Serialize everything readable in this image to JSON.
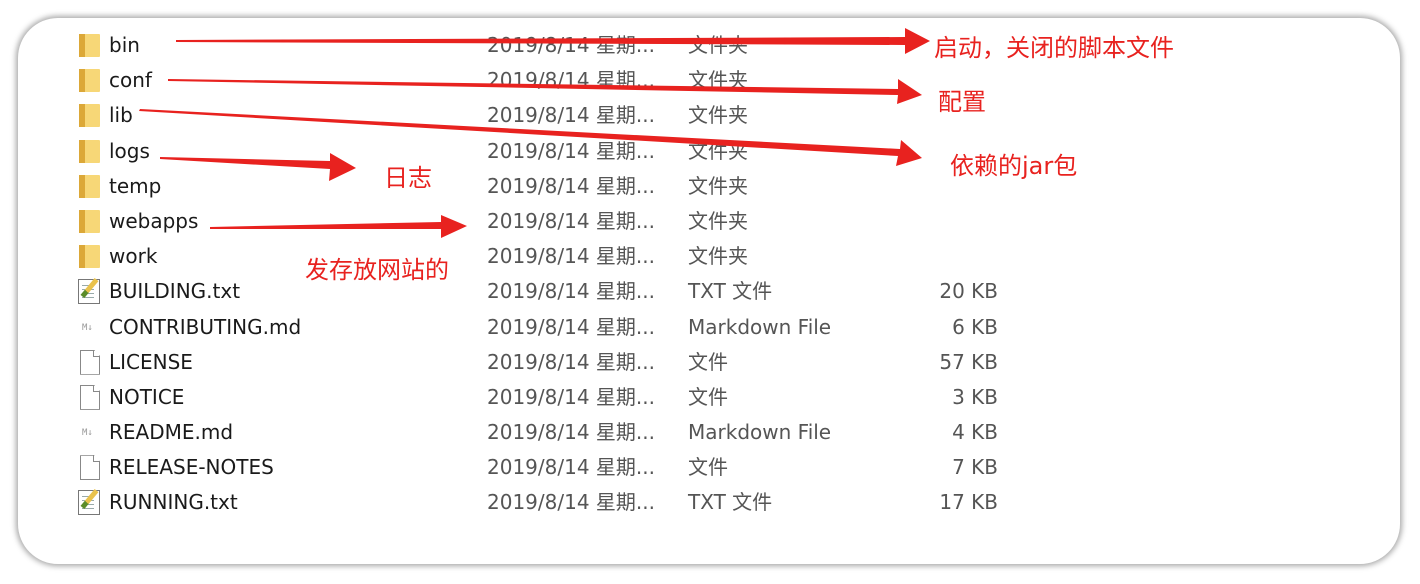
{
  "files": [
    {
      "name": "bin",
      "date": "2019/8/14 星期...",
      "type": "文件夹",
      "size": "",
      "icon": "folder-icon"
    },
    {
      "name": "conf",
      "date": "2019/8/14 星期...",
      "type": "文件夹",
      "size": "",
      "icon": "folder-icon"
    },
    {
      "name": "lib",
      "date": "2019/8/14 星期...",
      "type": "文件夹",
      "size": "",
      "icon": "folder-icon"
    },
    {
      "name": "logs",
      "date": "2019/8/14 星期...",
      "type": "文件夹",
      "size": "",
      "icon": "folder-icon"
    },
    {
      "name": "temp",
      "date": "2019/8/14 星期...",
      "type": "文件夹",
      "size": "",
      "icon": "folder-icon"
    },
    {
      "name": "webapps",
      "date": "2019/8/14 星期...",
      "type": "文件夹",
      "size": "",
      "icon": "folder-icon"
    },
    {
      "name": "work",
      "date": "2019/8/14 星期...",
      "type": "文件夹",
      "size": "",
      "icon": "folder-icon"
    },
    {
      "name": "BUILDING.txt",
      "date": "2019/8/14 星期...",
      "type": "TXT 文件",
      "size": "20 KB",
      "icon": "text-file-icon"
    },
    {
      "name": "CONTRIBUTING.md",
      "date": "2019/8/14 星期...",
      "type": "Markdown File",
      "size": "6 KB",
      "icon": "markdown-file-icon"
    },
    {
      "name": "LICENSE",
      "date": "2019/8/14 星期...",
      "type": "文件",
      "size": "57 KB",
      "icon": "blank-file-icon"
    },
    {
      "name": "NOTICE",
      "date": "2019/8/14 星期...",
      "type": "文件",
      "size": "3 KB",
      "icon": "blank-file-icon"
    },
    {
      "name": "README.md",
      "date": "2019/8/14 星期...",
      "type": "Markdown File",
      "size": "4 KB",
      "icon": "markdown-file-icon"
    },
    {
      "name": "RELEASE-NOTES",
      "date": "2019/8/14 星期...",
      "type": "文件",
      "size": "7 KB",
      "icon": "blank-file-icon"
    },
    {
      "name": "RUNNING.txt",
      "date": "2019/8/14 星期...",
      "type": "TXT 文件",
      "size": "17 KB",
      "icon": "text-file-icon"
    }
  ],
  "annotations": {
    "bin": "启动，关闭的脚本文件",
    "conf": "配置",
    "lib": "依赖的jar包",
    "logs": "日志",
    "webapps": "发存放网站的"
  },
  "colors": {
    "annotation": "#e8221f",
    "folder": "#f7d777"
  }
}
